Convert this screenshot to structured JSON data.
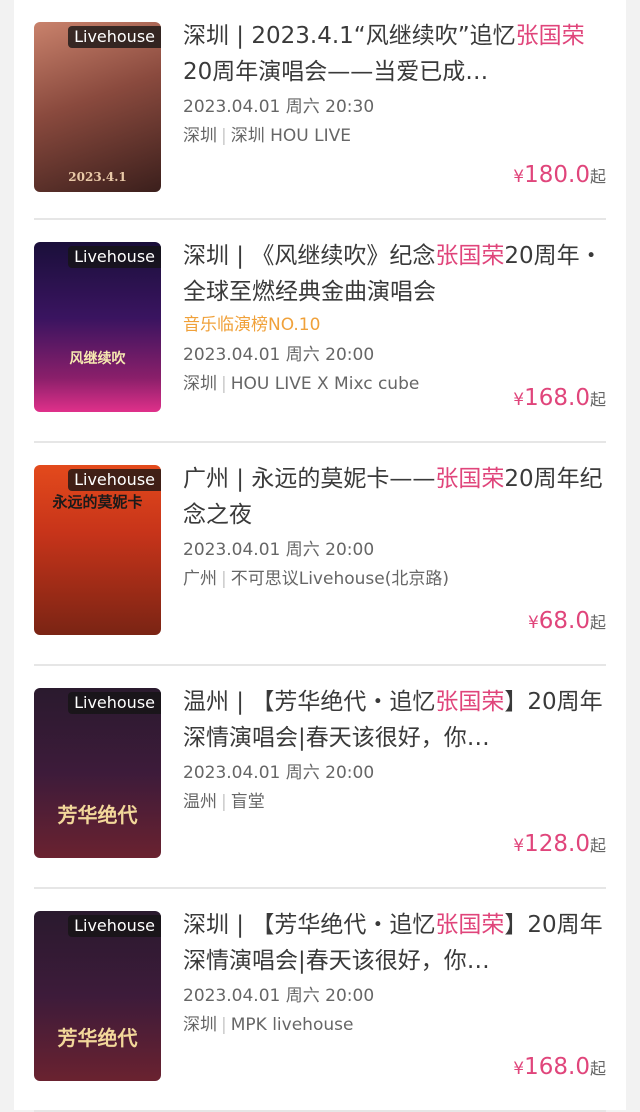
{
  "events": [
    {
      "title_pre": "深圳 | 2023.4.1“风继续吹”追忆",
      "title_hl": "张国荣",
      "title_post": "20周年演唱会——当爱已成…",
      "rank": "",
      "date": "2023.04.01 周六 20:30",
      "city": "深圳",
      "venue": "深圳 HOU LIVE",
      "price": "180.0",
      "tag": "Livehouse",
      "poster_text": "2023.4.1"
    },
    {
      "title_pre": "深圳 | 《风继续吹》纪念",
      "title_hl": "张国荣",
      "title_post": "20周年・全球至燃经典金曲演唱会",
      "rank": "音乐临演榜NO.10",
      "date": "2023.04.01 周六 20:00",
      "city": "深圳",
      "venue": "HOU LIVE X Mixc cube",
      "price": "168.0",
      "tag": "Livehouse",
      "poster_text": "风继续吹"
    },
    {
      "title_pre": "广州 | 永远的莫妮卡——",
      "title_hl": "张国荣",
      "title_post": "20周年纪念之夜",
      "rank": "",
      "date": "2023.04.01 周六 20:00",
      "city": "广州",
      "venue": "不可思议Livehouse(北京路)",
      "price": "68.0",
      "tag": "Livehouse",
      "poster_text": "永远的莫妮卡"
    },
    {
      "title_pre": "温州 | 【芳华绝代・追忆",
      "title_hl": "张国荣",
      "title_post": "】20周年深情演唱会|春天该很好，你…",
      "rank": "",
      "date": "2023.04.01 周六 20:00",
      "city": "温州",
      "venue": "盲堂",
      "price": "128.0",
      "tag": "Livehouse",
      "poster_text": "芳华绝代"
    },
    {
      "title_pre": "深圳 | 【芳华绝代・追忆",
      "title_hl": "张国荣",
      "title_post": "】20周年深情演唱会|春天该很好，你…",
      "rank": "",
      "date": "2023.04.01 周六 20:00",
      "city": "深圳",
      "venue": "MPK livehouse",
      "price": "168.0",
      "tag": "Livehouse",
      "poster_text": "芳华绝代"
    }
  ],
  "currency": "¥",
  "price_suffix": "起",
  "colors": {
    "accent": "#e0457b",
    "rank": "#f0a13a"
  }
}
